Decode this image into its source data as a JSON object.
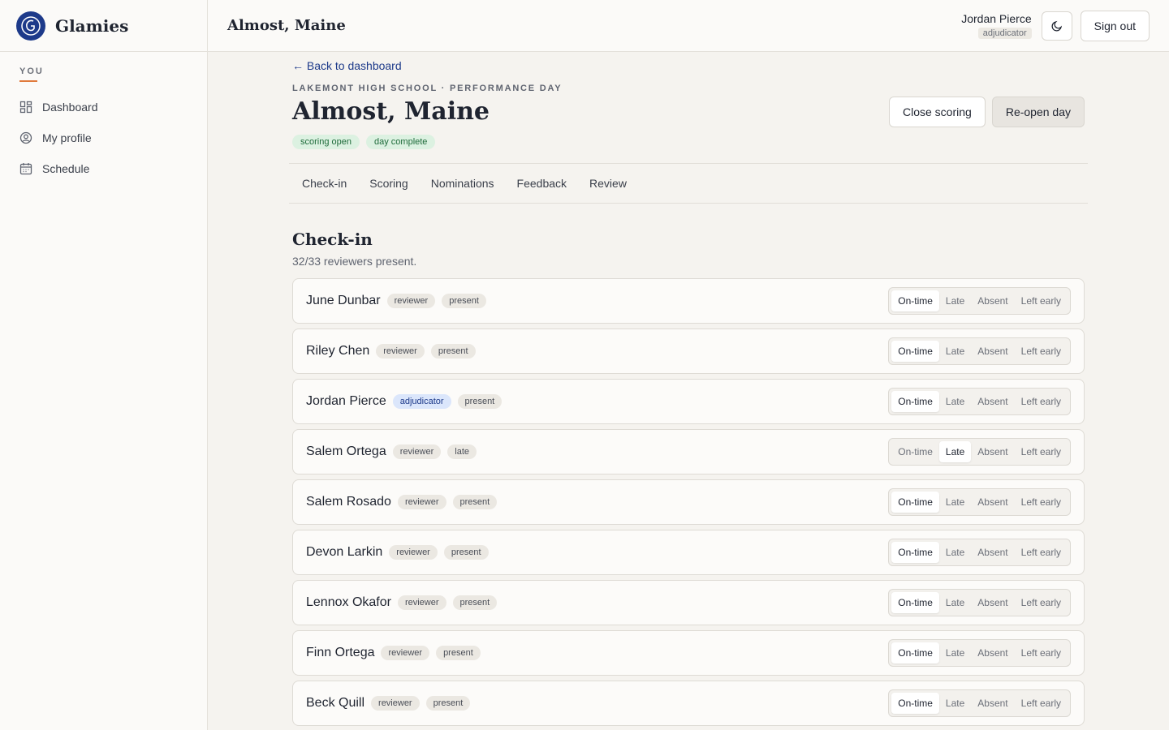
{
  "app": {
    "name": "Glamies"
  },
  "sidebar": {
    "heading": "YOU",
    "items": [
      {
        "label": "Dashboard",
        "icon": "dashboard-grid-icon"
      },
      {
        "label": "My profile",
        "icon": "user-circle-icon"
      },
      {
        "label": "Schedule",
        "icon": "calendar-icon"
      }
    ]
  },
  "header": {
    "title": "Almost, Maine",
    "user_name": "Jordan Pierce",
    "user_role": "adjudicator",
    "theme_icon": "moon-icon",
    "sign_out_label": "Sign out"
  },
  "page": {
    "back_label": "← Back to dashboard",
    "eyebrow": "LAKEMONT HIGH SCHOOL · PERFORMANCE DAY",
    "title": "Almost, Maine",
    "badges": [
      "scoring open",
      "day complete"
    ],
    "close_scoring_label": "Close scoring",
    "reopen_label": "Re-open day",
    "tabs": [
      "Check-in",
      "Scoring",
      "Nominations",
      "Feedback",
      "Review"
    ]
  },
  "checkin": {
    "title": "Check-in",
    "summary": "32/33 reviewers present.",
    "options": [
      "On-time",
      "Late",
      "Absent",
      "Left early"
    ],
    "rows": [
      {
        "name": "June Dunbar",
        "role": "reviewer",
        "status": "present",
        "selected": "On-time"
      },
      {
        "name": "Riley Chen",
        "role": "reviewer",
        "status": "present",
        "selected": "On-time"
      },
      {
        "name": "Jordan Pierce",
        "role": "adjudicator",
        "status": "present",
        "selected": "On-time"
      },
      {
        "name": "Salem Ortega",
        "role": "reviewer",
        "status": "late",
        "selected": "Late"
      },
      {
        "name": "Salem Rosado",
        "role": "reviewer",
        "status": "present",
        "selected": "On-time"
      },
      {
        "name": "Devon Larkin",
        "role": "reviewer",
        "status": "present",
        "selected": "On-time"
      },
      {
        "name": "Lennox Okafor",
        "role": "reviewer",
        "status": "present",
        "selected": "On-time"
      },
      {
        "name": "Finn Ortega",
        "role": "reviewer",
        "status": "present",
        "selected": "On-time"
      },
      {
        "name": "Beck Quill",
        "role": "reviewer",
        "status": "present",
        "selected": "On-time"
      }
    ]
  },
  "colors": {
    "brand": "#1d3a8a",
    "accent": "#e07a3c",
    "status_green_bg": "#dcf1e1",
    "adjudicator_bg": "#dbe6fb"
  }
}
